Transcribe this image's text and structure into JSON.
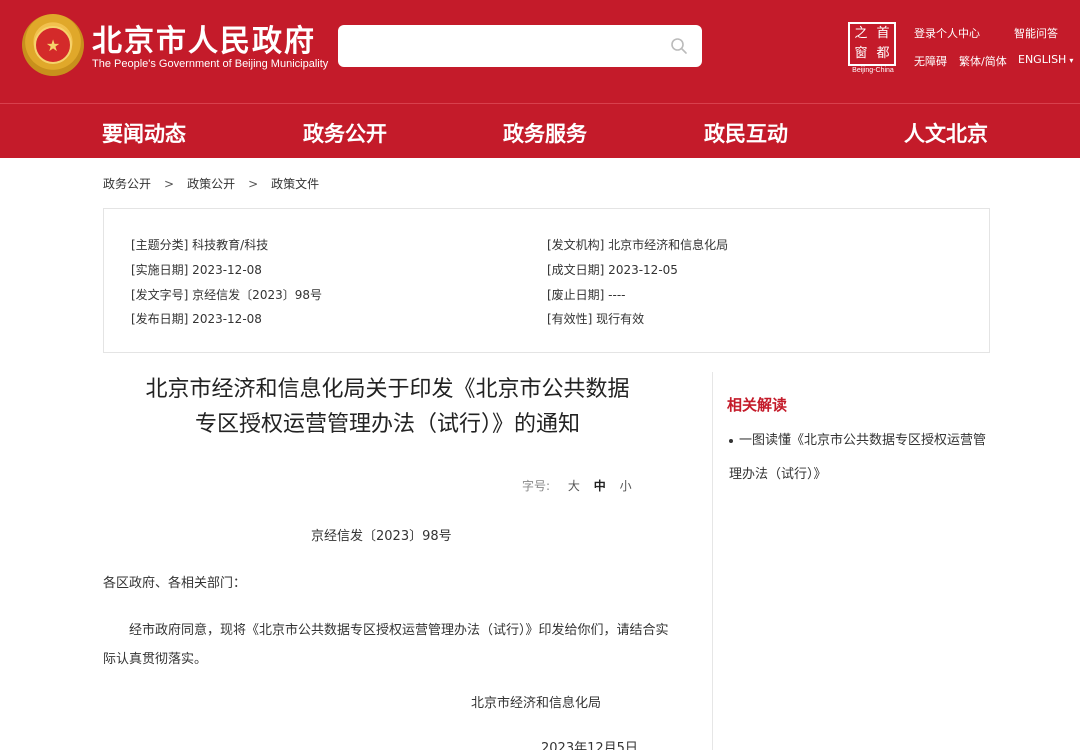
{
  "header": {
    "title": "北京市人民政府",
    "subtitle": "The People's Government of Beijing Municipality",
    "search": {
      "value": "",
      "placeholder": ""
    },
    "capital_logo": {
      "chars": [
        "之",
        "首",
        "窗",
        "都"
      ],
      "caption": "Beijing-China"
    },
    "utility_links": {
      "login": "登录个人中心",
      "smart_qa": "智能问答",
      "accessibility": "无障碍",
      "traditional": "繁体/简体",
      "english": "ENGLISH"
    }
  },
  "nav": [
    "要闻动态",
    "政务公开",
    "政务服务",
    "政民互动",
    "人文北京"
  ],
  "breadcrumb": [
    "政务公开",
    "政策公开",
    "政策文件"
  ],
  "meta": {
    "topic": "[主题分类] 科技教育/科技",
    "issuer": "[发文机构] 北京市经济和信息化局",
    "effective_date": "[实施日期] 2023-12-08",
    "written_date": "[成文日期] 2023-12-05",
    "doc_no": "[发文字号] 京经信发〔2023〕98号",
    "expiry_date": "[废止日期] ----",
    "publish_date": "[发布日期] 2023-12-08",
    "validity": "[有效性] 现行有效"
  },
  "article": {
    "title_line1": "北京市经济和信息化局关于印发《北京市公共数据",
    "title_line2": "专区授权运营管理办法（试行）》的通知",
    "font_size_label": "字号:",
    "font_sizes": [
      "大",
      "中",
      "小"
    ],
    "doc_number": "京经信发〔2023〕98号",
    "salutation": "各区政府、各相关部门：",
    "body": "经市政府同意，现将《北京市公共数据专区授权运营管理办法（试行）》印发给你们，请结合实际认真贯彻落实。",
    "signer": "北京市经济和信息化局",
    "date": "2023年12月5日"
  },
  "sidebar": {
    "title": "相关解读",
    "items": [
      "一图读懂《北京市公共数据专区授权运营管理办法（试行）》"
    ]
  },
  "colors": {
    "brand_red": "#c41b2a",
    "text": "#333333"
  }
}
